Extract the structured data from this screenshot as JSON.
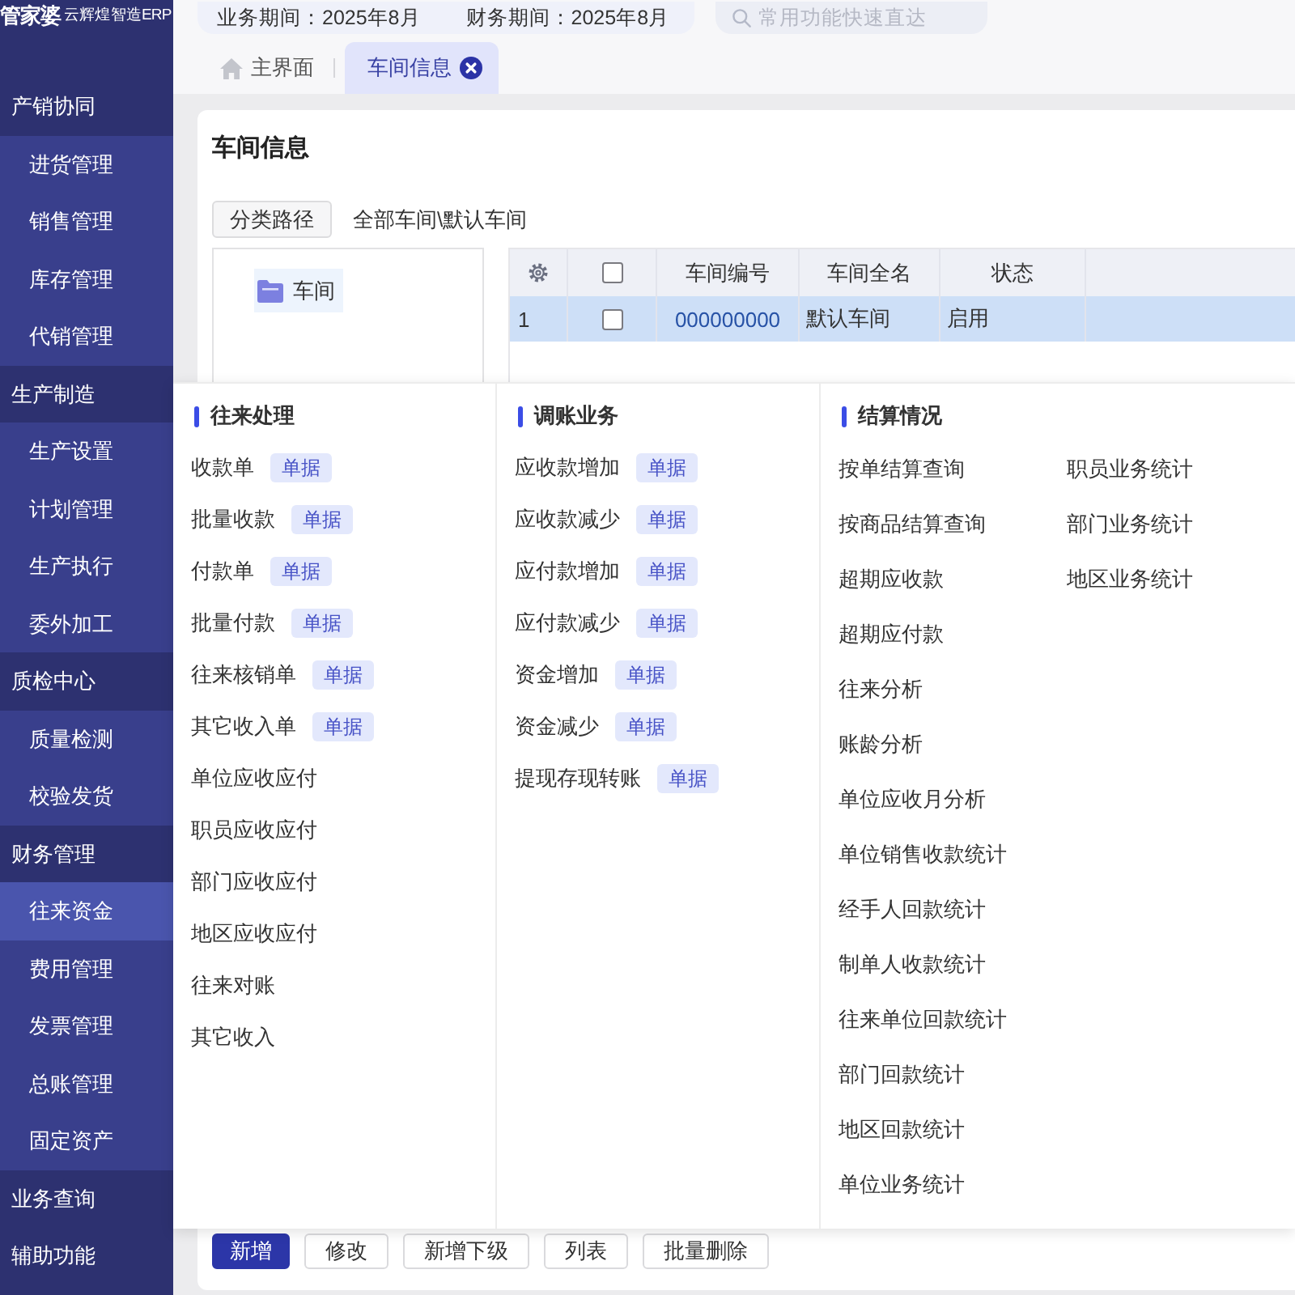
{
  "logo": {
    "brand": "管家婆",
    "product": "云辉煌智造ERP"
  },
  "sidebar": {
    "groups": [
      {
        "label": "产销协同",
        "children": [
          {
            "label": "进货管理",
            "selected": false
          },
          {
            "label": "销售管理",
            "selected": false
          },
          {
            "label": "库存管理",
            "selected": false
          },
          {
            "label": "代销管理",
            "selected": false
          }
        ]
      },
      {
        "label": "生产制造",
        "children": [
          {
            "label": "生产设置",
            "selected": false
          },
          {
            "label": "计划管理",
            "selected": false
          },
          {
            "label": "生产执行",
            "selected": false
          },
          {
            "label": "委外加工",
            "selected": false
          }
        ]
      },
      {
        "label": "质检中心",
        "children": [
          {
            "label": "质量检测",
            "selected": false
          },
          {
            "label": "校验发货",
            "selected": false
          }
        ]
      },
      {
        "label": "财务管理",
        "children": [
          {
            "label": "往来资金",
            "selected": true
          },
          {
            "label": "费用管理",
            "selected": false
          },
          {
            "label": "发票管理",
            "selected": false
          },
          {
            "label": "总账管理",
            "selected": false
          },
          {
            "label": "固定资产",
            "selected": false
          }
        ]
      },
      {
        "label": "业务查询"
      },
      {
        "label": "辅助功能"
      }
    ]
  },
  "top_bar": {
    "periods": [
      "业务期间：2025年8月",
      "财务期间：2025年8月"
    ],
    "search": {
      "placeholder": "常用功能快速直达"
    }
  },
  "tabs": [
    {
      "label": "主界面",
      "kind": "home",
      "selected": false,
      "closable": false
    },
    {
      "label": "车间信息",
      "kind": "page",
      "selected": true,
      "closable": true
    }
  ],
  "page": {
    "title": "车间信息",
    "path_button": "分类路径",
    "path": "全部车间\\默认车间",
    "tree": [
      {
        "label": "车间",
        "selected": true
      }
    ],
    "table": {
      "header_checked": false,
      "columns": [
        "车间编号",
        "车间全名",
        "状态"
      ],
      "rows": [
        {
          "number": "1",
          "checked": false,
          "selected": true,
          "cells": [
            "000000000",
            "默认车间",
            "启用"
          ]
        }
      ]
    },
    "buttons": [
      {
        "label": "新增",
        "kind": "primary"
      },
      {
        "label": "修改",
        "kind": "default"
      },
      {
        "label": "新增下级",
        "kind": "default"
      },
      {
        "label": "列表",
        "kind": "default"
      },
      {
        "label": "批量删除",
        "kind": "default"
      }
    ]
  },
  "menu": {
    "columns": [
      {
        "title": "往来处理",
        "lists": [
          [
            {
              "label": "收款单",
              "badge": "单据"
            },
            {
              "label": "批量收款",
              "badge": "单据"
            },
            {
              "label": "付款单",
              "badge": "单据"
            },
            {
              "label": "批量付款",
              "badge": "单据"
            },
            {
              "label": "往来核销单",
              "badge": "单据"
            },
            {
              "label": "其它收入单",
              "badge": "单据"
            },
            {
              "label": "单位应收应付"
            },
            {
              "label": "职员应收应付"
            },
            {
              "label": "部门应收应付"
            },
            {
              "label": "地区应收应付"
            },
            {
              "label": "往来对账"
            },
            {
              "label": "其它收入"
            }
          ]
        ]
      },
      {
        "title": "调账业务",
        "lists": [
          [
            {
              "label": "应收款增加",
              "badge": "单据"
            },
            {
              "label": "应收款减少",
              "badge": "单据"
            },
            {
              "label": "应付款增加",
              "badge": "单据"
            },
            {
              "label": "应付款减少",
              "badge": "单据"
            },
            {
              "label": "资金增加",
              "badge": "单据"
            },
            {
              "label": "资金减少",
              "badge": "单据"
            },
            {
              "label": "提现存现转账",
              "badge": "单据"
            }
          ]
        ]
      },
      {
        "title": "结算情况",
        "lists": [
          [
            {
              "label": "按单结算查询"
            },
            {
              "label": "按商品结算查询"
            },
            {
              "label": "超期应收款"
            },
            {
              "label": "超期应付款"
            },
            {
              "label": "往来分析"
            },
            {
              "label": "账龄分析"
            },
            {
              "label": "单位应收月分析"
            },
            {
              "label": "单位销售收款统计"
            },
            {
              "label": "经手人回款统计"
            },
            {
              "label": "制单人收款统计"
            },
            {
              "label": "往来单位回款统计"
            },
            {
              "label": "部门回款统计"
            },
            {
              "label": "地区回款统计"
            },
            {
              "label": "单位业务统计"
            }
          ],
          [
            {
              "label": "职员业务统计"
            },
            {
              "label": "部门业务统计"
            },
            {
              "label": "地区业务统计"
            }
          ]
        ]
      }
    ]
  }
}
